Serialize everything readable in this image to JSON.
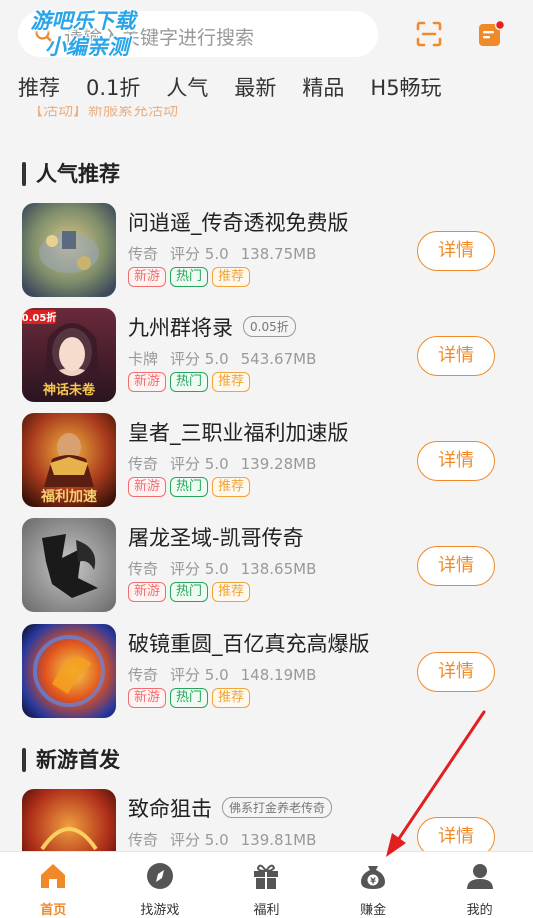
{
  "watermark": {
    "line1": "游吧乐下载",
    "line2": "小编亲测"
  },
  "search": {
    "placeholder": "请输入关键字进行搜索"
  },
  "icons": {
    "scan": "scan-icon",
    "message": "message-icon"
  },
  "tabs": [
    "推荐",
    "0.1折",
    "人气",
    "最新",
    "精品",
    "H5畅玩"
  ],
  "notice": "【活动】新服累充活动",
  "section_popular": "人气推荐",
  "section_new": "新游首发",
  "games": [
    {
      "name": "问逍遥_传奇透视免费版",
      "badge": "",
      "genre": "传奇",
      "score": "评分 5.0",
      "size": "138.75MB",
      "tags": [
        "新游",
        "热门",
        "推荐"
      ],
      "button": "详情"
    },
    {
      "name": "九州群将录",
      "badge": "0.05折",
      "genre": "卡牌",
      "score": "评分 5.0",
      "size": "543.67MB",
      "tags": [
        "新游",
        "热门",
        "推荐"
      ],
      "button": "详情"
    },
    {
      "name": "皇者_三职业福利加速版",
      "badge": "",
      "genre": "传奇",
      "score": "评分 5.0",
      "size": "139.28MB",
      "tags": [
        "新游",
        "热门",
        "推荐"
      ],
      "button": "详情"
    },
    {
      "name": "屠龙圣域-凯哥传奇",
      "badge": "",
      "genre": "传奇",
      "score": "评分 5.0",
      "size": "138.65MB",
      "tags": [
        "新游",
        "热门",
        "推荐"
      ],
      "button": "详情"
    },
    {
      "name": "破镜重圆_百亿真充高爆版",
      "badge": "",
      "genre": "传奇",
      "score": "评分 5.0",
      "size": "148.19MB",
      "tags": [
        "新游",
        "热门",
        "推荐"
      ],
      "button": "详情"
    },
    {
      "name": "致命狙击",
      "badge": "佛系打金养老传奇",
      "genre": "传奇",
      "score": "评分 5.0",
      "size": "139.81MB",
      "tags": [],
      "button": "详情"
    }
  ],
  "thumb_text": {
    "t1": "0.05折",
    "t2": "神话未卷",
    "t3": "福利加速"
  },
  "nav": [
    {
      "label": "首页",
      "icon": "home-icon",
      "active": true
    },
    {
      "label": "找游戏",
      "icon": "compass-icon",
      "active": false
    },
    {
      "label": "福利",
      "icon": "gift-icon",
      "active": false
    },
    {
      "label": "赚金",
      "icon": "money-bag-icon",
      "active": false
    },
    {
      "label": "我的",
      "icon": "user-icon",
      "active": false
    }
  ],
  "colors": {
    "accent": "#f08a28",
    "background": "#f4f4f4",
    "annotation_arrow": "#e02020"
  }
}
